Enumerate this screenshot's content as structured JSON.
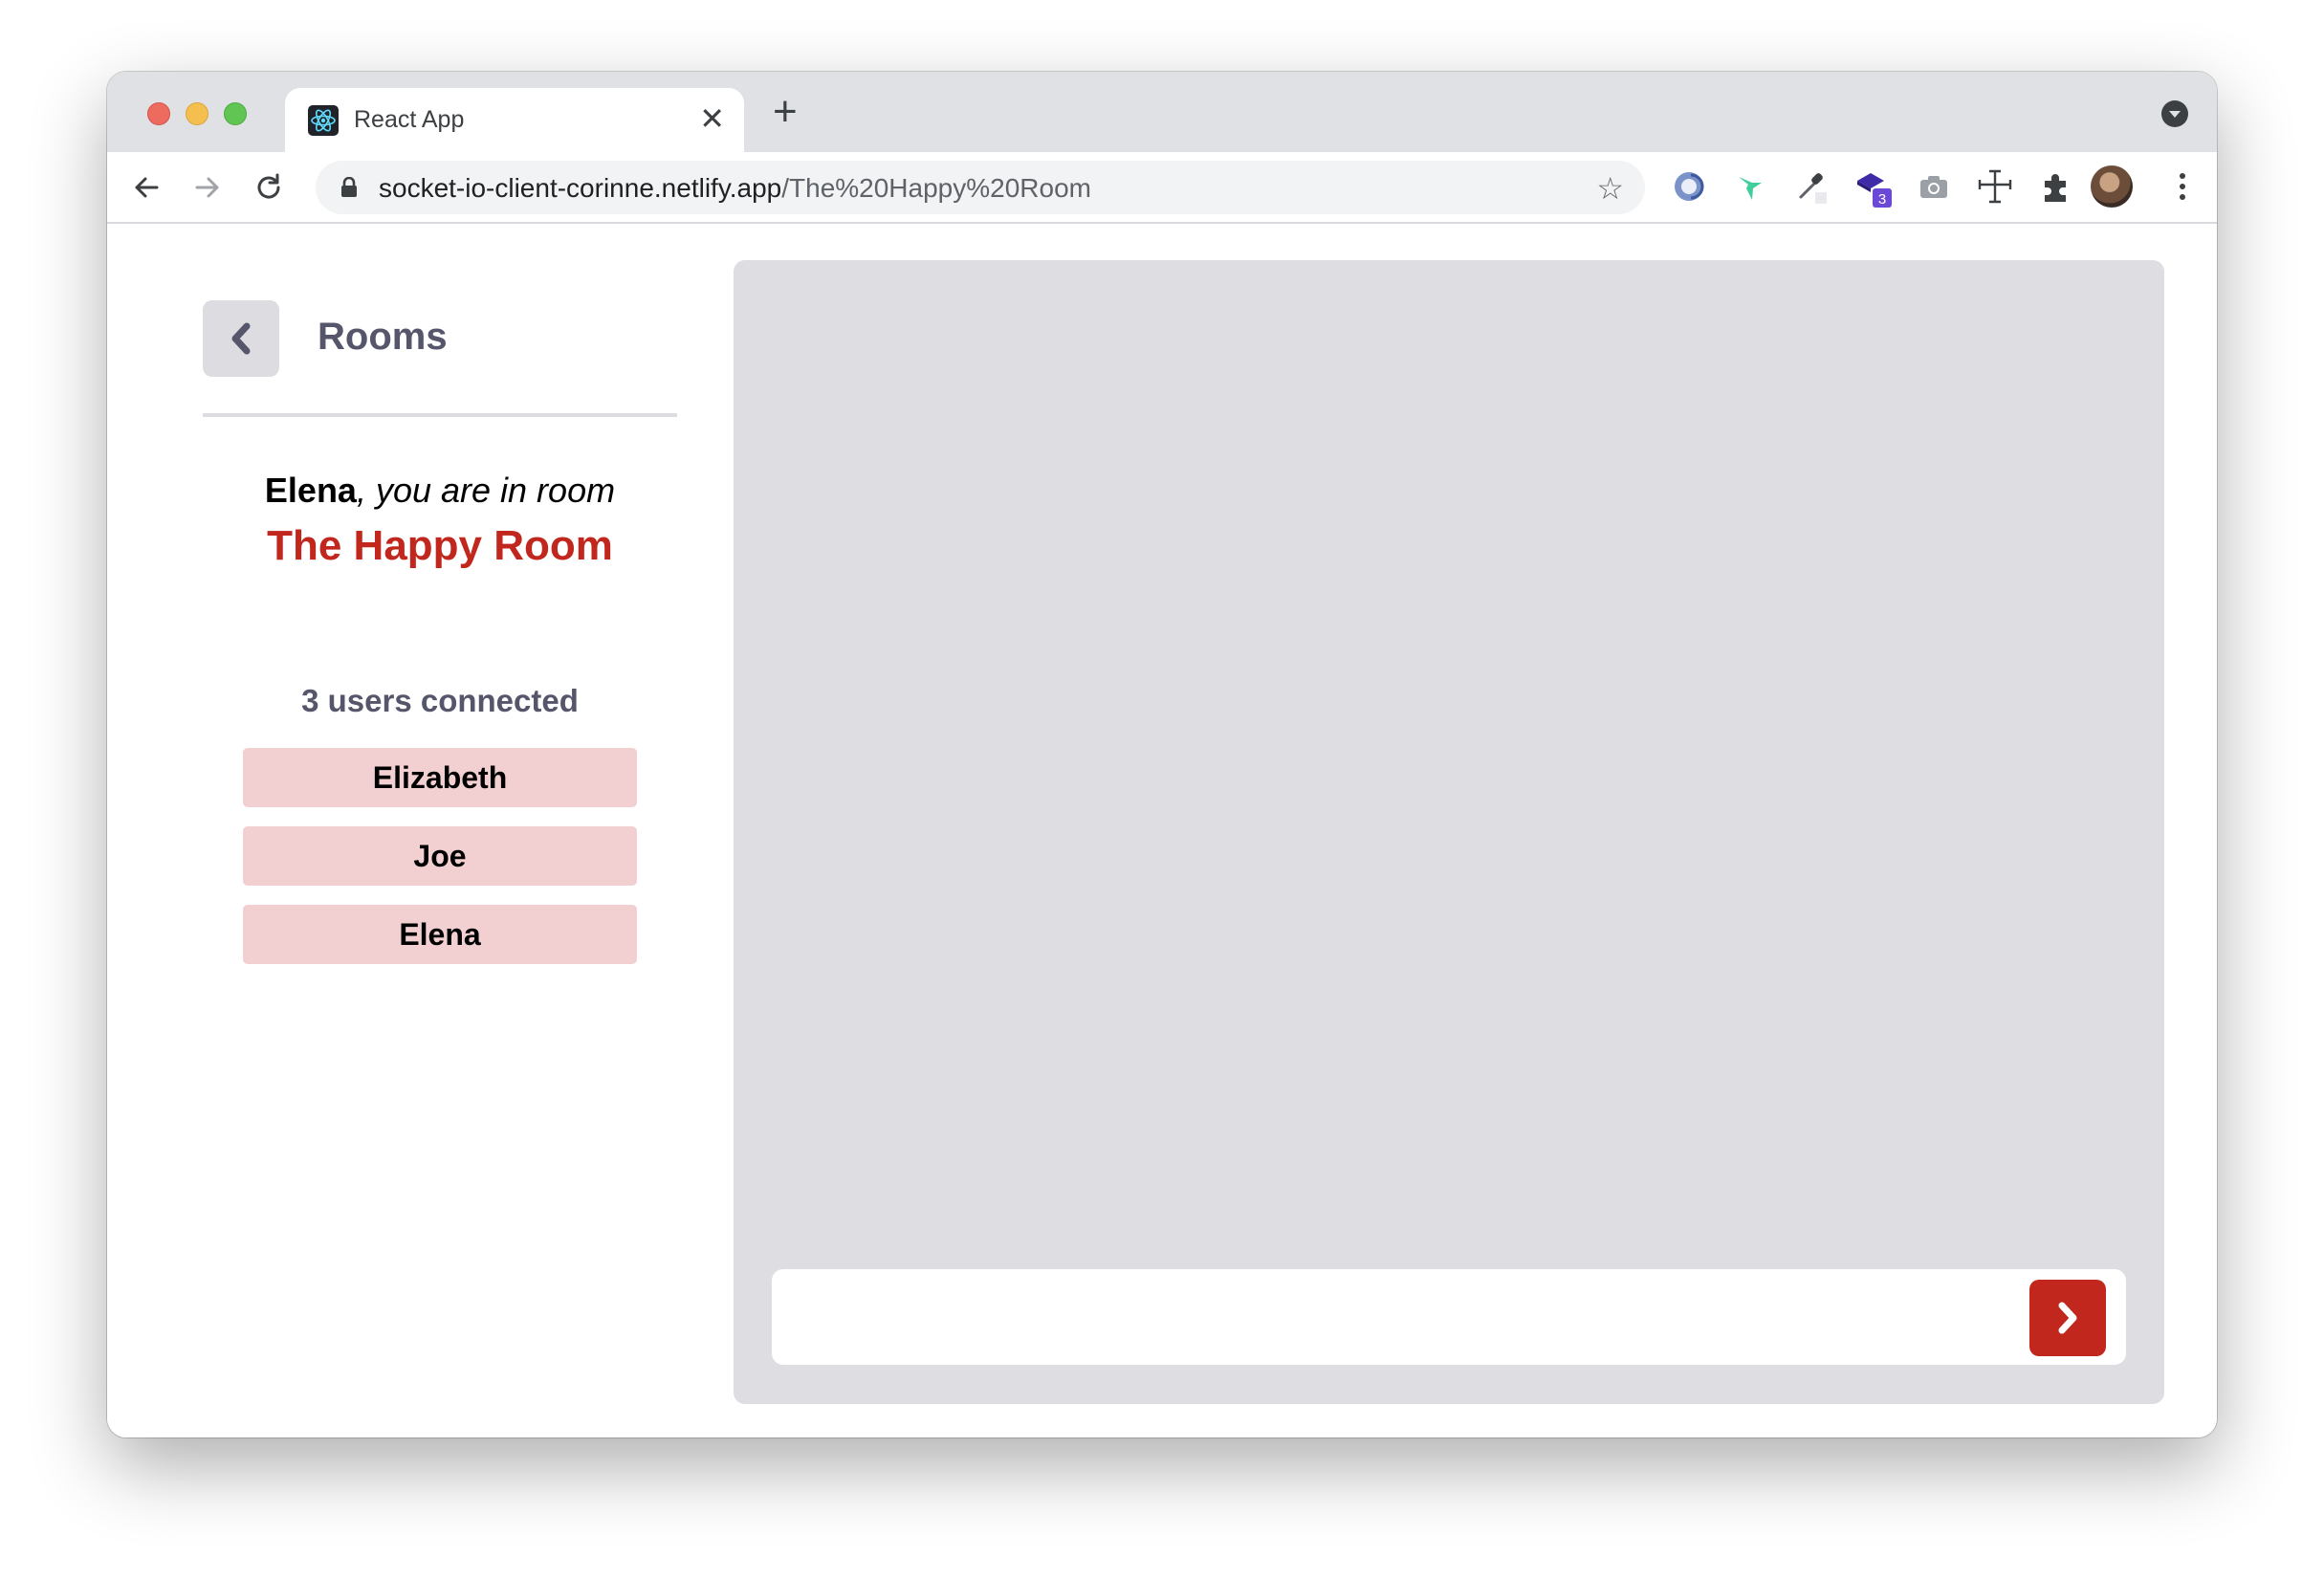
{
  "browser": {
    "tab": {
      "title": "React App",
      "close": "✕"
    },
    "new_tab": "+",
    "address": {
      "domain": "socket-io-client-corinne.netlify.app",
      "path": "/The%20Happy%20Room"
    },
    "bookmark_star": "☆",
    "extension_badge": "3"
  },
  "sidebar": {
    "back_label": "Rooms",
    "user_name": "Elena",
    "greeting_rest": ", you are in room",
    "room_name": "The Happy Room",
    "users_connected": "3 users connected",
    "users": [
      "Elizabeth",
      "Joe",
      "Elena"
    ]
  },
  "chat": {
    "input_value": "",
    "input_placeholder": ""
  },
  "colors": {
    "accent_red": "#c1271d",
    "user_chip": "#f2cfd0",
    "panel_gray": "#dddde2"
  }
}
